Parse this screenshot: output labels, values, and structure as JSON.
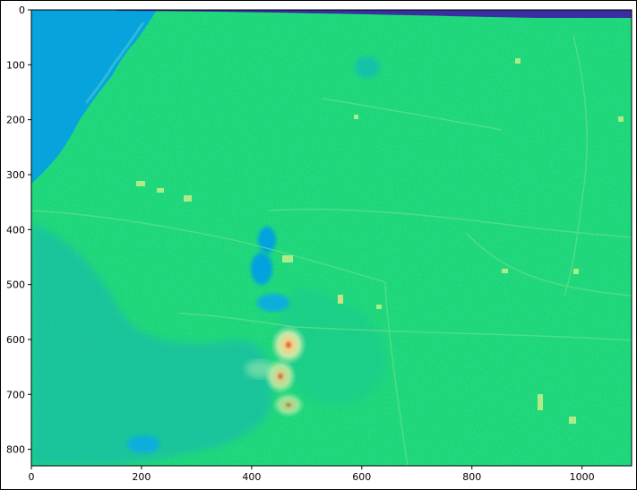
{
  "chart_data": {
    "type": "heatmap",
    "title": "",
    "xlabel": "",
    "ylabel": "",
    "xlim": [
      0,
      1090
    ],
    "ylim": [
      830,
      0
    ],
    "x_ticks": [
      {
        "value": 0,
        "label": "0"
      },
      {
        "value": 200,
        "label": "200"
      },
      {
        "value": 400,
        "label": "400"
      },
      {
        "value": 600,
        "label": "600"
      },
      {
        "value": 800,
        "label": "800"
      },
      {
        "value": 1000,
        "label": "1000"
      }
    ],
    "y_ticks": [
      {
        "value": 0,
        "label": "0"
      },
      {
        "value": 100,
        "label": "100"
      },
      {
        "value": 200,
        "label": "200"
      },
      {
        "value": 300,
        "label": "300"
      },
      {
        "value": 400,
        "label": "400"
      },
      {
        "value": 500,
        "label": "500"
      },
      {
        "value": 600,
        "label": "600"
      },
      {
        "value": 700,
        "label": "700"
      },
      {
        "value": 800,
        "label": "800"
      }
    ],
    "grid": false,
    "colormap": "terrain-like (blue → green → yellow → red)",
    "colors": {
      "base": "#1ed676",
      "water": "#06a3dd",
      "low": "#15b6b5",
      "high": "#c8f08a",
      "hot": "#e06030",
      "nodata": "#3a2fa0"
    }
  }
}
